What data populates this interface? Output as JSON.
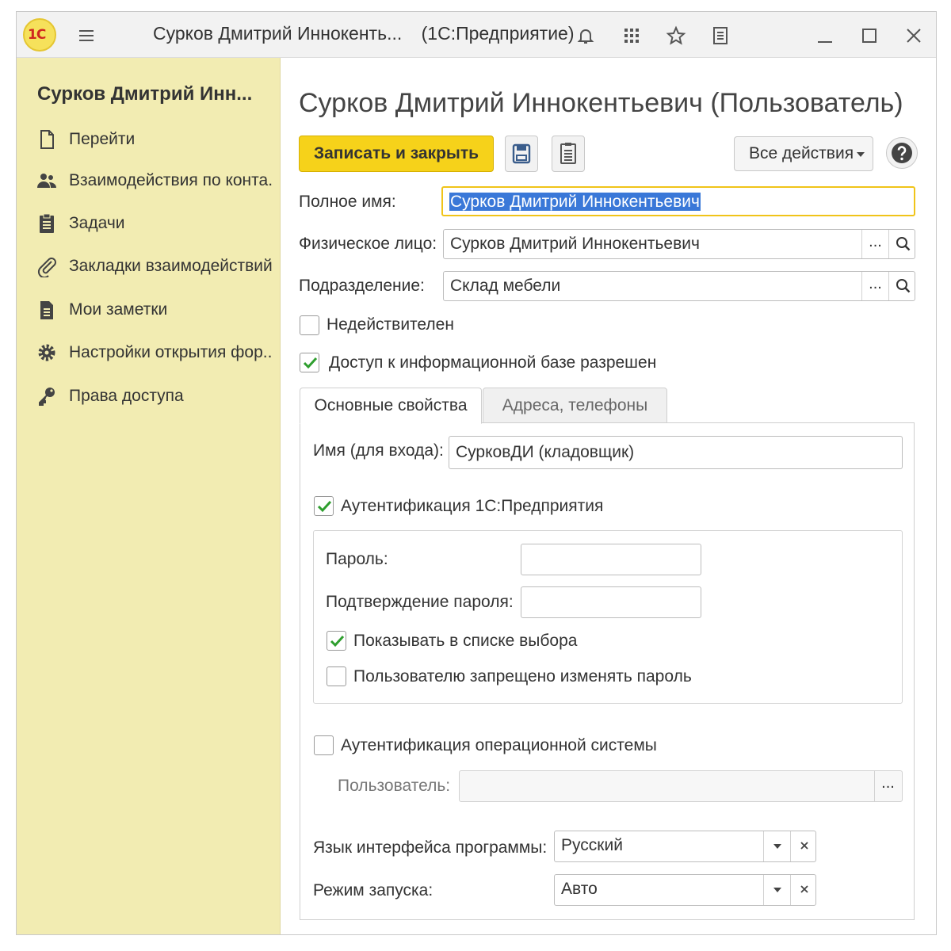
{
  "titlebar": {
    "logo_text": "1С",
    "title": "Сурков Дмитрий Иннокенть...",
    "app_name": "(1С:Предприятие)",
    "icons": [
      "menu-icon",
      "bell-icon",
      "apps-grid-icon",
      "star-icon",
      "history-icon",
      "minimize-icon",
      "maximize-icon",
      "close-icon"
    ]
  },
  "sidebar": {
    "title": "Сурков Дмитрий Инн...",
    "items": [
      {
        "label": "Перейти",
        "icon": "document-icon"
      },
      {
        "label": "Взаимодействия по конта...",
        "icon": "people-icon"
      },
      {
        "label": "Задачи",
        "icon": "clipboard-icon"
      },
      {
        "label": "Закладки взаимодействий",
        "icon": "paperclip-icon"
      },
      {
        "label": "Мои заметки",
        "icon": "note-icon"
      },
      {
        "label": "Настройки открытия фор...",
        "icon": "gear-icon"
      },
      {
        "label": "Права доступа",
        "icon": "key-icon"
      }
    ]
  },
  "form": {
    "title": "Сурков Дмитрий Иннокентьевич (Пользователь)",
    "toolbar": {
      "save_close_label": "Записать и закрыть",
      "all_actions_label": "Все действия"
    },
    "full_name": {
      "label": "Полное имя:",
      "value": "Сурков Дмитрий Иннокентьевич"
    },
    "individual": {
      "label": "Физическое лицо:",
      "value": "Сурков Дмитрий Иннокентьевич",
      "ellipsis": "..."
    },
    "department": {
      "label": "Подразделение:",
      "value": "Склад мебели",
      "ellipsis": "..."
    },
    "invalid": {
      "label": "Недействителен",
      "checked": false
    },
    "access_allowed": {
      "label": "Доступ к информационной базе разрешен",
      "checked": true
    },
    "tabs": [
      {
        "label": "Основные свойства",
        "active": true
      },
      {
        "label": "Адреса, телефоны",
        "active": false
      }
    ],
    "main_props": {
      "login": {
        "label": "Имя (для входа):",
        "value": "СурковДИ (кладовщик)"
      },
      "auth_1c": {
        "label": "Аутентификация 1С:Предприятия",
        "checked": true
      },
      "password": {
        "label": "Пароль:",
        "value": ""
      },
      "password_confirm": {
        "label": "Подтверждение пароля:",
        "value": ""
      },
      "show_in_list": {
        "label": "Показывать в списке выбора",
        "checked": true
      },
      "cannot_change_password": {
        "label": "Пользователю запрещено изменять пароль",
        "checked": false
      },
      "auth_os": {
        "label": "Аутентификация операционной системы",
        "checked": false
      },
      "os_user": {
        "label": "Пользователь:",
        "value": "",
        "ellipsis": "..."
      },
      "language": {
        "label": "Язык интерфейса программы:",
        "value": "Русский"
      },
      "run_mode": {
        "label": "Режим запуска:",
        "value": "Авто"
      }
    }
  },
  "colors": {
    "sidebar_bg": "#f2ecb2",
    "primary_button": "#f6d21a",
    "check_green": "#2e9e2e",
    "selection_blue": "#3a78d8"
  }
}
